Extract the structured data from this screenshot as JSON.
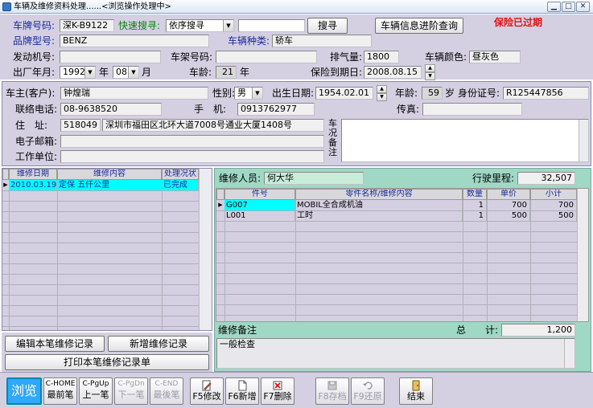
{
  "window": {
    "title": "车辆及维修资料处理......<浏览操作处理中>"
  },
  "vehicle": {
    "plate_label": "车牌号码:",
    "plate_value": "深K-B9122",
    "quick_search_label": "快速搜寻:",
    "quick_search_mode": "依序搜寻",
    "search_button": "搜寻",
    "advanced_query_button": "车辆信息进阶查询",
    "insurance_status": "保险已过期",
    "brand_label": "品牌型号:",
    "brand_value": "BENZ",
    "type_label": "车辆种类:",
    "type_value": "轿车",
    "engine_label": "发动机号:",
    "engine_value": "",
    "frame_label": "车架号码:",
    "frame_value": "",
    "displacement_label": "排气量:",
    "displacement_value": "1800",
    "color_label": "车辆颜色:",
    "color_value": "昼灰色",
    "mfg_label": "出厂年月:",
    "mfg_year": "1992",
    "year_unit": "年",
    "mfg_month": "08",
    "month_unit": "月",
    "age_label": "车龄:",
    "age_value": "21",
    "age_unit": "年",
    "insurance_label": "保险到期日:",
    "insurance_value": "2008.08.15"
  },
  "owner": {
    "owner_label": "车主(客户):",
    "owner_value": "钟煌瑞",
    "gender_label": "性别:",
    "gender_value": "男",
    "birth_label": "出生日期:",
    "birth_value": "1954.02.01",
    "age_label": "年龄:",
    "age_value": "59",
    "age_unit": "岁",
    "id_label": "身份证号:",
    "id_value": "R125447856",
    "phone_label": "联络电话:",
    "phone_value": "08-9638520",
    "mobile_label": "手　机:",
    "mobile_value": "0913762977",
    "fax_label": "传真:",
    "fax_value": "",
    "address_label": "住　址:",
    "postcode_value": "518049",
    "address_value": "深圳市福田区北环大道7008号通业大厦1408号",
    "notes_label": "车况备注",
    "notes_value": "",
    "email_label": "电子邮箱:",
    "email_value": "",
    "work_label": "工作单位:",
    "work_value": ""
  },
  "repair_list": {
    "columns": [
      "维修日期",
      "维修内容",
      "处理况状"
    ],
    "rows": [
      {
        "date": "2010.03.19",
        "content": "定保 五仟公里",
        "status": "已完成"
      }
    ]
  },
  "detail": {
    "mechanic_label": "维修人员:",
    "mechanic_value": "何大华",
    "mileage_label": "行驶里程:",
    "mileage_value": "32,507",
    "columns": [
      "件号",
      "零件名称/维修内容",
      "数量",
      "单价",
      "小计"
    ],
    "rows": [
      {
        "part": "G007",
        "name": "MOBIL全合成机油",
        "qty": "1",
        "price": "700",
        "subtotal": "700"
      },
      {
        "part": "L001",
        "name": "工时",
        "qty": "1",
        "price": "500",
        "subtotal": "500"
      }
    ],
    "remarks_label": "维修备注",
    "total_label": "总　　计:",
    "total_value": "1,200",
    "remarks_value": "一般检查"
  },
  "actions": {
    "edit_repair": "编辑本笔维修记录",
    "add_repair": "新增维修记录",
    "print_repair": "打印本笔维修记录单"
  },
  "toolbar": {
    "browse": "浏览",
    "first_key": "C-HOME",
    "first_label": "最前笔",
    "prev_key": "C-PgUp",
    "prev_label": "上一笔",
    "next_key": "C-PgDn",
    "next_label": "下一笔",
    "last_key": "C-END",
    "last_label": "最後笔",
    "edit": "F5修改",
    "add": "F6新增",
    "delete": "F7删除",
    "save": "F8存档",
    "restore": "F9还原",
    "exit": "结束"
  },
  "colors": {
    "accent_red": "#e01010",
    "detail_panel": "#9fd8c4",
    "selected_row": "#00ffff",
    "form_bg": "#d4d0e2"
  }
}
